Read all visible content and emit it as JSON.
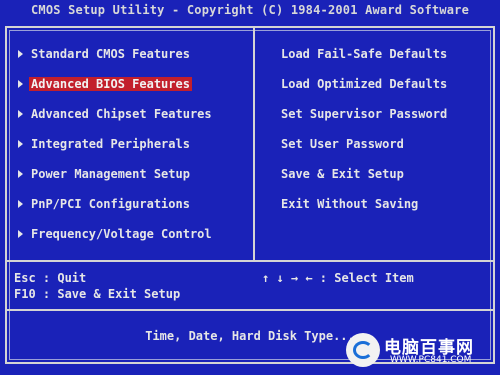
{
  "title": "CMOS Setup Utility - Copyright (C) 1984-2001 Award Software",
  "left_menu": [
    {
      "label": "Standard CMOS Features",
      "selected": false
    },
    {
      "label": "Advanced BIOS Features",
      "selected": true
    },
    {
      "label": "Advanced Chipset Features",
      "selected": false
    },
    {
      "label": "Integrated Peripherals",
      "selected": false
    },
    {
      "label": "Power Management Setup",
      "selected": false
    },
    {
      "label": "PnP/PCI Configurations",
      "selected": false
    },
    {
      "label": "Frequency/Voltage Control",
      "selected": false
    }
  ],
  "right_menu": [
    {
      "label": "Load Fail-Safe Defaults"
    },
    {
      "label": "Load Optimized Defaults"
    },
    {
      "label": "Set Supervisor Password"
    },
    {
      "label": "Set User Password"
    },
    {
      "label": "Save & Exit Setup"
    },
    {
      "label": "Exit Without Saving"
    }
  ],
  "keys": {
    "esc": "Esc : Quit",
    "f10": "F10 : Save & Exit Setup",
    "arrows": "↑ ↓ → ←   : Select Item"
  },
  "status_text": "Time, Date, Hard Disk Type...",
  "watermark": {
    "title": "电脑百事网",
    "url": "WWW.PC841.COM"
  },
  "colors": {
    "background": "#1a22b8",
    "highlight": "#c21f2c",
    "text": "#e6e6e6"
  }
}
